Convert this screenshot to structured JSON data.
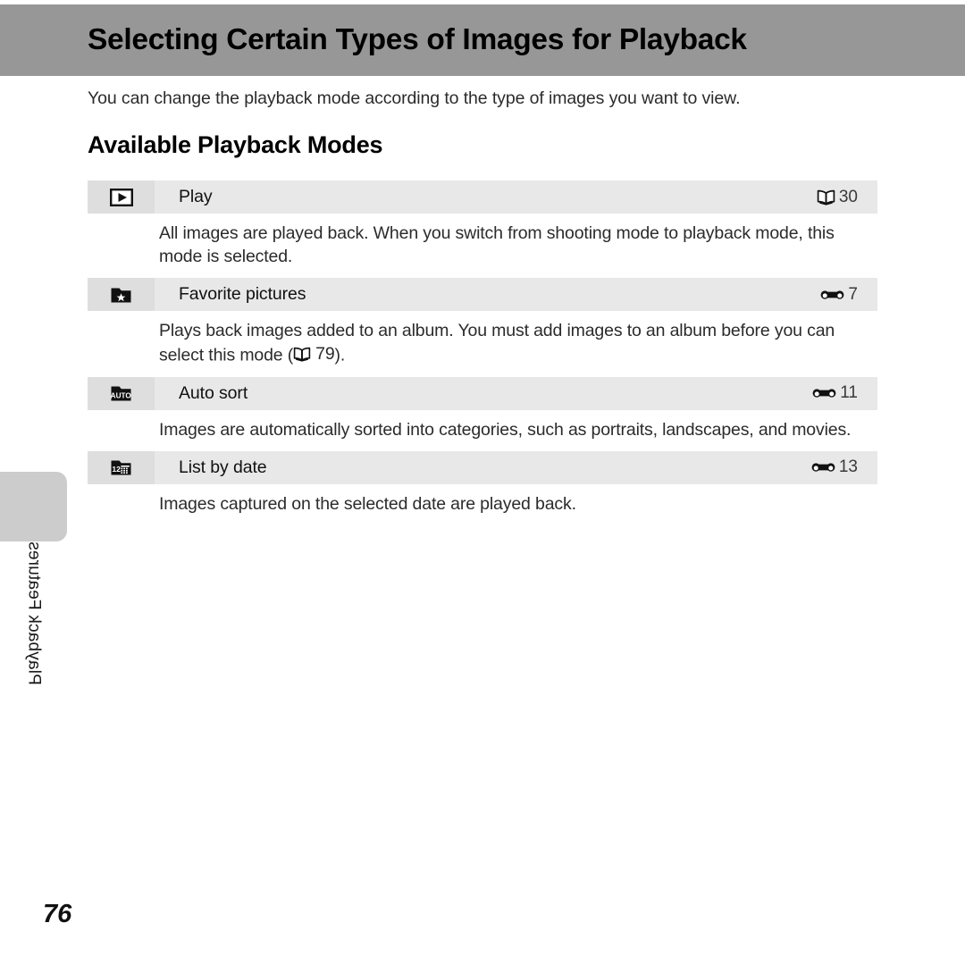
{
  "header": {
    "title": "Selecting Certain Types of Images for Playback",
    "band_color": "#979797"
  },
  "intro": {
    "text": "You can change the playback mode according to the type of images you want to view."
  },
  "section": {
    "heading": "Available Playback Modes"
  },
  "table": {
    "rows": [
      {
        "icon": "play-button-icon",
        "name": "Play",
        "ref_icon": "open-book-icon",
        "ref_page": "30",
        "description": "All images are played back. When you switch from shooting mode to playback mode, this mode is selected."
      },
      {
        "icon": "favorite-folder-star-icon",
        "name": "Favorite pictures",
        "ref_icon": "reference-section-icon",
        "ref_page": "7",
        "description_before": "Plays back images added to an album. You must add images to an album before you can select this mode (",
        "inline_ref_icon": "open-book-icon",
        "inline_ref_page": "79",
        "description_after": ")."
      },
      {
        "icon": "auto-sort-folder-icon",
        "name": "Auto sort",
        "ref_icon": "reference-section-icon",
        "ref_page": "11",
        "description": "Images are automatically sorted into categories, such as portraits, landscapes, and movies."
      },
      {
        "icon": "list-by-date-folder-icon",
        "name": "List by date",
        "ref_icon": "reference-section-icon",
        "ref_page": "13",
        "description": "Images captured on the selected date are played back."
      }
    ]
  },
  "sidebar": {
    "tab_label": "Playback Features"
  },
  "footer": {
    "page_number": "76"
  }
}
